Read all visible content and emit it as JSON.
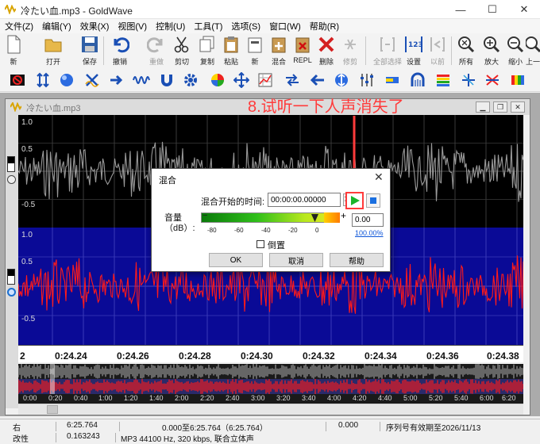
{
  "window": {
    "title": "冷たい血.mp3 - GoldWave"
  },
  "menu": [
    "文件(Z)",
    "编辑(Y)",
    "效果(X)",
    "视图(V)",
    "控制(U)",
    "工具(T)",
    "选项(S)",
    "窗口(W)",
    "帮助(R)"
  ],
  "toolbar": [
    {
      "label": "新",
      "icon": "new-file-icon",
      "enabled": true
    },
    {
      "label": "打开",
      "icon": "open-folder-icon",
      "enabled": true
    },
    {
      "label": "保存",
      "icon": "save-disk-icon",
      "enabled": true
    },
    {
      "label": "撤销",
      "icon": "undo-icon",
      "enabled": true
    },
    {
      "label": "重做",
      "icon": "redo-icon",
      "enabled": false
    },
    {
      "label": "剪切",
      "icon": "scissors-icon",
      "enabled": true
    },
    {
      "label": "复制",
      "icon": "copy-icon",
      "enabled": true
    },
    {
      "label": "粘贴",
      "icon": "paste-icon",
      "enabled": true
    },
    {
      "label": "新",
      "icon": "paste-new-icon",
      "enabled": true
    },
    {
      "label": "混合",
      "icon": "mix-icon",
      "enabled": true
    },
    {
      "label": "REPL",
      "icon": "replace-icon",
      "enabled": true
    },
    {
      "label": "删除",
      "icon": "delete-x-icon",
      "enabled": true
    },
    {
      "label": "修剪",
      "icon": "trim-icon",
      "enabled": false
    },
    {
      "label": "全部选择",
      "icon": "select-all-icon",
      "enabled": false
    },
    {
      "label": "设置",
      "icon": "set-marker-icon",
      "enabled": true
    },
    {
      "label": "以前",
      "icon": "previous-icon",
      "enabled": false
    },
    {
      "label": "所有",
      "icon": "zoom-all-icon",
      "enabled": true
    },
    {
      "label": "放大",
      "icon": "zoom-in-icon",
      "enabled": true
    },
    {
      "label": "缩小",
      "icon": "zoom-out-icon",
      "enabled": true
    },
    {
      "label": "上一",
      "icon": "zoom-previous-icon",
      "enabled": true
    }
  ],
  "document": {
    "title": "冷たい血.mp3"
  },
  "annotation": {
    "text": "8.试听一下人声消失了",
    "color": "#ff3b3b"
  },
  "waveform": {
    "top_labels": [
      "1.0",
      "0.5",
      "-0.5"
    ],
    "bottom_labels": [
      "1.0",
      "0.5",
      "-0.5"
    ],
    "top_color": "#9a9a9a",
    "bottom_color": "#ff1a1a",
    "bottom_bg": "#0a0a96"
  },
  "timeline": {
    "start_label": "2",
    "labels": [
      "0:24.24",
      "0:24.26",
      "0:24.28",
      "0:24.30",
      "0:24.32",
      "0:24.34",
      "0:24.36",
      "0:24.38"
    ]
  },
  "overview": {
    "labels": [
      "0:00",
      "0:20",
      "0:40",
      "1:00",
      "1:20",
      "1:40",
      "2:00",
      "2:20",
      "2:40",
      "3:00",
      "3:20",
      "3:40",
      "4:00",
      "4:20",
      "4:40",
      "5:00",
      "5:20",
      "5:40",
      "6:00",
      "6:20"
    ]
  },
  "status": {
    "row1": [
      "右",
      "6:25.764",
      "0.000至6:25.764（6:25.764）",
      "0.000",
      "序列号有效期至2026/11/13"
    ],
    "row2": [
      "改性",
      "0.163243",
      "MP3 44100 Hz, 320 kbps, 联合立体声"
    ]
  },
  "dialog": {
    "title": "混合",
    "start_time_label": "混合开始的时间:",
    "start_time_value": "00:00:00.00000",
    "volume_label": "音量（dB）:",
    "volume_ticks": [
      "-80",
      "-60",
      "-40",
      "-20",
      "0"
    ],
    "volume_value": "0.00",
    "volume_percent": "100.00%",
    "reverse_label": "倒置",
    "reverse_checked": false,
    "ok_label": "OK",
    "cancel_label": "取消",
    "help_label": "帮助"
  }
}
